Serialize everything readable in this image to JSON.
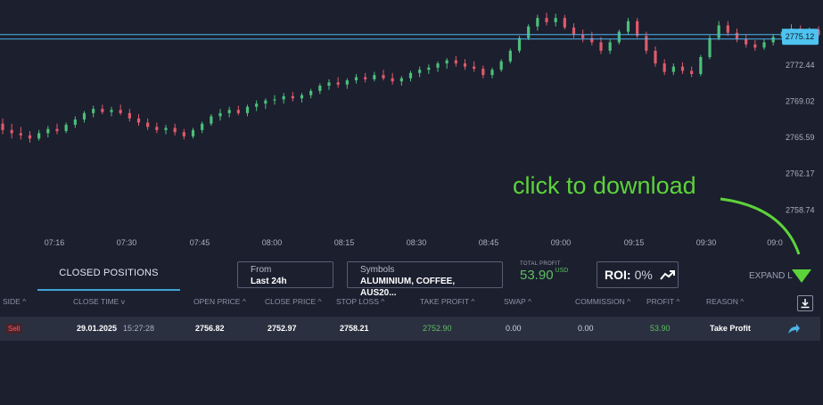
{
  "chart_data": {
    "type": "candlestick",
    "y_ticks": [
      "2775.12",
      "2772.44",
      "2769.02",
      "2765.59",
      "2762.17",
      "2758.74"
    ],
    "x_ticks": [
      "07:16",
      "07:30",
      "07:45",
      "08:00",
      "08:15",
      "08:30",
      "08:45",
      "09:00",
      "09:15",
      "09:30",
      "09:0"
    ],
    "current_price": "2775.12",
    "ylim": [
      2757.0,
      2778.6
    ],
    "up_color": "#4cbf7a",
    "down_color": "#e05a6a",
    "price_line_color": "#4fb3e8",
    "candles": [
      {
        "o": 2766.9,
        "h": 2767.4,
        "l": 2765.9,
        "c": 2766.3
      },
      {
        "o": 2766.3,
        "h": 2766.9,
        "l": 2765.5,
        "c": 2766.0
      },
      {
        "o": 2766.0,
        "h": 2766.6,
        "l": 2765.4,
        "c": 2765.8
      },
      {
        "o": 2765.8,
        "h": 2766.2,
        "l": 2765.1,
        "c": 2765.5
      },
      {
        "o": 2765.5,
        "h": 2766.3,
        "l": 2765.3,
        "c": 2766.0
      },
      {
        "o": 2766.0,
        "h": 2766.7,
        "l": 2765.6,
        "c": 2766.4
      },
      {
        "o": 2766.4,
        "h": 2766.9,
        "l": 2765.9,
        "c": 2766.2
      },
      {
        "o": 2766.2,
        "h": 2767.0,
        "l": 2766.0,
        "c": 2766.8
      },
      {
        "o": 2766.8,
        "h": 2767.6,
        "l": 2766.5,
        "c": 2767.3
      },
      {
        "o": 2767.3,
        "h": 2768.1,
        "l": 2767.0,
        "c": 2767.9
      },
      {
        "o": 2767.9,
        "h": 2768.6,
        "l": 2767.5,
        "c": 2768.3
      },
      {
        "o": 2768.3,
        "h": 2768.7,
        "l": 2767.8,
        "c": 2768.0
      },
      {
        "o": 2768.0,
        "h": 2768.5,
        "l": 2767.6,
        "c": 2768.2
      },
      {
        "o": 2768.2,
        "h": 2768.7,
        "l": 2767.7,
        "c": 2767.9
      },
      {
        "o": 2767.9,
        "h": 2768.3,
        "l": 2767.1,
        "c": 2767.4
      },
      {
        "o": 2767.4,
        "h": 2767.8,
        "l": 2766.7,
        "c": 2767.0
      },
      {
        "o": 2767.0,
        "h": 2767.4,
        "l": 2766.3,
        "c": 2766.6
      },
      {
        "o": 2766.6,
        "h": 2767.0,
        "l": 2766.0,
        "c": 2766.3
      },
      {
        "o": 2766.3,
        "h": 2766.8,
        "l": 2765.9,
        "c": 2766.5
      },
      {
        "o": 2766.5,
        "h": 2766.9,
        "l": 2765.8,
        "c": 2766.1
      },
      {
        "o": 2766.1,
        "h": 2766.4,
        "l": 2765.4,
        "c": 2765.7
      },
      {
        "o": 2765.7,
        "h": 2766.5,
        "l": 2765.5,
        "c": 2766.3
      },
      {
        "o": 2766.3,
        "h": 2767.1,
        "l": 2766.0,
        "c": 2766.9
      },
      {
        "o": 2766.9,
        "h": 2767.8,
        "l": 2766.7,
        "c": 2767.6
      },
      {
        "o": 2767.6,
        "h": 2768.3,
        "l": 2767.2,
        "c": 2767.9
      },
      {
        "o": 2767.9,
        "h": 2768.5,
        "l": 2767.5,
        "c": 2768.2
      },
      {
        "o": 2768.2,
        "h": 2768.6,
        "l": 2767.7,
        "c": 2767.9
      },
      {
        "o": 2767.9,
        "h": 2768.7,
        "l": 2767.6,
        "c": 2768.5
      },
      {
        "o": 2768.5,
        "h": 2769.1,
        "l": 2768.1,
        "c": 2768.8
      },
      {
        "o": 2768.8,
        "h": 2769.3,
        "l": 2768.3,
        "c": 2769.1
      },
      {
        "o": 2769.1,
        "h": 2769.6,
        "l": 2768.7,
        "c": 2769.2
      },
      {
        "o": 2769.2,
        "h": 2769.8,
        "l": 2768.8,
        "c": 2769.5
      },
      {
        "o": 2769.5,
        "h": 2769.9,
        "l": 2769.0,
        "c": 2769.3
      },
      {
        "o": 2769.3,
        "h": 2769.8,
        "l": 2768.9,
        "c": 2769.6
      },
      {
        "o": 2769.6,
        "h": 2770.2,
        "l": 2769.3,
        "c": 2770.0
      },
      {
        "o": 2770.0,
        "h": 2770.7,
        "l": 2769.7,
        "c": 2770.5
      },
      {
        "o": 2770.5,
        "h": 2771.1,
        "l": 2770.1,
        "c": 2770.8
      },
      {
        "o": 2770.8,
        "h": 2771.3,
        "l": 2770.3,
        "c": 2770.6
      },
      {
        "o": 2770.6,
        "h": 2771.2,
        "l": 2770.2,
        "c": 2771.0
      },
      {
        "o": 2771.0,
        "h": 2771.6,
        "l": 2770.7,
        "c": 2771.3
      },
      {
        "o": 2771.3,
        "h": 2771.7,
        "l": 2770.8,
        "c": 2771.1
      },
      {
        "o": 2771.1,
        "h": 2771.8,
        "l": 2770.9,
        "c": 2771.5
      },
      {
        "o": 2771.5,
        "h": 2772.0,
        "l": 2771.0,
        "c": 2771.2
      },
      {
        "o": 2771.2,
        "h": 2771.7,
        "l": 2770.6,
        "c": 2770.9
      },
      {
        "o": 2770.9,
        "h": 2771.4,
        "l": 2770.5,
        "c": 2771.2
      },
      {
        "o": 2771.2,
        "h": 2771.9,
        "l": 2770.9,
        "c": 2771.7
      },
      {
        "o": 2771.7,
        "h": 2772.3,
        "l": 2771.3,
        "c": 2772.0
      },
      {
        "o": 2772.0,
        "h": 2772.5,
        "l": 2771.6,
        "c": 2772.2
      },
      {
        "o": 2772.2,
        "h": 2772.8,
        "l": 2771.8,
        "c": 2772.6
      },
      {
        "o": 2772.6,
        "h": 2773.1,
        "l": 2772.1,
        "c": 2772.9
      },
      {
        "o": 2772.9,
        "h": 2773.3,
        "l": 2772.3,
        "c": 2772.6
      },
      {
        "o": 2772.6,
        "h": 2773.0,
        "l": 2772.0,
        "c": 2772.3
      },
      {
        "o": 2772.3,
        "h": 2772.8,
        "l": 2771.8,
        "c": 2772.1
      },
      {
        "o": 2772.1,
        "h": 2772.4,
        "l": 2771.2,
        "c": 2771.5
      },
      {
        "o": 2771.5,
        "h": 2772.2,
        "l": 2771.2,
        "c": 2772.0
      },
      {
        "o": 2772.0,
        "h": 2773.0,
        "l": 2771.8,
        "c": 2772.8
      },
      {
        "o": 2772.8,
        "h": 2774.0,
        "l": 2772.6,
        "c": 2773.8
      },
      {
        "o": 2773.8,
        "h": 2775.2,
        "l": 2773.6,
        "c": 2775.0
      },
      {
        "o": 2775.0,
        "h": 2776.3,
        "l": 2774.8,
        "c": 2776.1
      },
      {
        "o": 2776.1,
        "h": 2777.2,
        "l": 2775.7,
        "c": 2776.9
      },
      {
        "o": 2776.9,
        "h": 2777.4,
        "l": 2776.2,
        "c": 2776.5
      },
      {
        "o": 2776.5,
        "h": 2777.3,
        "l": 2776.1,
        "c": 2776.9
      },
      {
        "o": 2776.9,
        "h": 2777.2,
        "l": 2775.8,
        "c": 2776.0
      },
      {
        "o": 2776.0,
        "h": 2776.4,
        "l": 2775.0,
        "c": 2775.3
      },
      {
        "o": 2775.3,
        "h": 2775.8,
        "l": 2774.6,
        "c": 2775.0
      },
      {
        "o": 2775.0,
        "h": 2775.6,
        "l": 2774.3,
        "c": 2774.6
      },
      {
        "o": 2774.6,
        "h": 2775.1,
        "l": 2773.5,
        "c": 2773.8
      },
      {
        "o": 2773.8,
        "h": 2774.9,
        "l": 2773.5,
        "c": 2774.6
      },
      {
        "o": 2774.6,
        "h": 2775.8,
        "l": 2774.4,
        "c": 2775.6
      },
      {
        "o": 2775.6,
        "h": 2776.9,
        "l": 2775.3,
        "c": 2776.6
      },
      {
        "o": 2776.6,
        "h": 2776.9,
        "l": 2775.0,
        "c": 2775.2
      },
      {
        "o": 2775.2,
        "h": 2775.6,
        "l": 2773.5,
        "c": 2773.8
      },
      {
        "o": 2773.8,
        "h": 2774.2,
        "l": 2772.3,
        "c": 2772.6
      },
      {
        "o": 2772.6,
        "h": 2773.0,
        "l": 2771.5,
        "c": 2771.8
      },
      {
        "o": 2771.8,
        "h": 2772.6,
        "l": 2771.5,
        "c": 2772.3
      },
      {
        "o": 2772.3,
        "h": 2772.7,
        "l": 2771.6,
        "c": 2771.9
      },
      {
        "o": 2771.9,
        "h": 2772.3,
        "l": 2771.3,
        "c": 2771.6
      },
      {
        "o": 2771.6,
        "h": 2773.4,
        "l": 2771.4,
        "c": 2773.2
      },
      {
        "o": 2773.2,
        "h": 2775.3,
        "l": 2773.0,
        "c": 2775.0
      },
      {
        "o": 2775.0,
        "h": 2776.6,
        "l": 2774.8,
        "c": 2776.2
      },
      {
        "o": 2776.2,
        "h": 2776.6,
        "l": 2775.2,
        "c": 2775.5
      },
      {
        "o": 2775.5,
        "h": 2775.9,
        "l": 2774.6,
        "c": 2774.9
      },
      {
        "o": 2774.9,
        "h": 2775.3,
        "l": 2774.1,
        "c": 2774.4
      },
      {
        "o": 2774.4,
        "h": 2774.8,
        "l": 2773.8,
        "c": 2774.1
      },
      {
        "o": 2774.1,
        "h": 2774.9,
        "l": 2773.9,
        "c": 2774.6
      },
      {
        "o": 2774.6,
        "h": 2775.4,
        "l": 2774.3,
        "c": 2775.1
      },
      {
        "o": 2775.1,
        "h": 2775.9,
        "l": 2774.8,
        "c": 2775.6
      },
      {
        "o": 2775.6,
        "h": 2776.3,
        "l": 2775.2,
        "c": 2775.9
      },
      {
        "o": 2775.9,
        "h": 2776.2,
        "l": 2775.0,
        "c": 2775.4
      },
      {
        "o": 2775.4,
        "h": 2776.0,
        "l": 2775.1,
        "c": 2775.8
      },
      {
        "o": 2775.8,
        "h": 2776.1,
        "l": 2775.1,
        "c": 2775.3
      }
    ]
  },
  "annotation": {
    "text": "click to download"
  },
  "panel": {
    "tab_label": "CLOSED POSITIONS",
    "from": {
      "label": "From",
      "value": "Last 24h"
    },
    "symbols": {
      "label": "Symbols",
      "value": "ALUMINIUM, COFFEE, AUS20..."
    },
    "total_profit": {
      "label": "TOTAL PROFIT",
      "value": "53.90",
      "currency": "USD"
    },
    "roi": {
      "label": "ROI:",
      "value": "0%"
    },
    "expand_label": "EXPAND L",
    "headers": [
      "SIDE",
      "CLOSE TIME",
      "OPEN PRICE",
      "CLOSE PRICE",
      "STOP LOSS",
      "TAKE PROFIT",
      "SWAP",
      "COMMISSION",
      "PROFIT",
      "REASON"
    ],
    "row": {
      "side": "Sell",
      "close_date": "29.01.2025",
      "close_time": "15:27:28",
      "open_price": "2756.82",
      "close_price": "2752.97",
      "stop_loss": "2758.21",
      "take_profit": "2752.90",
      "swap": "0.00",
      "commission": "0.00",
      "profit": "53.90",
      "reason": "Take Profit"
    }
  }
}
